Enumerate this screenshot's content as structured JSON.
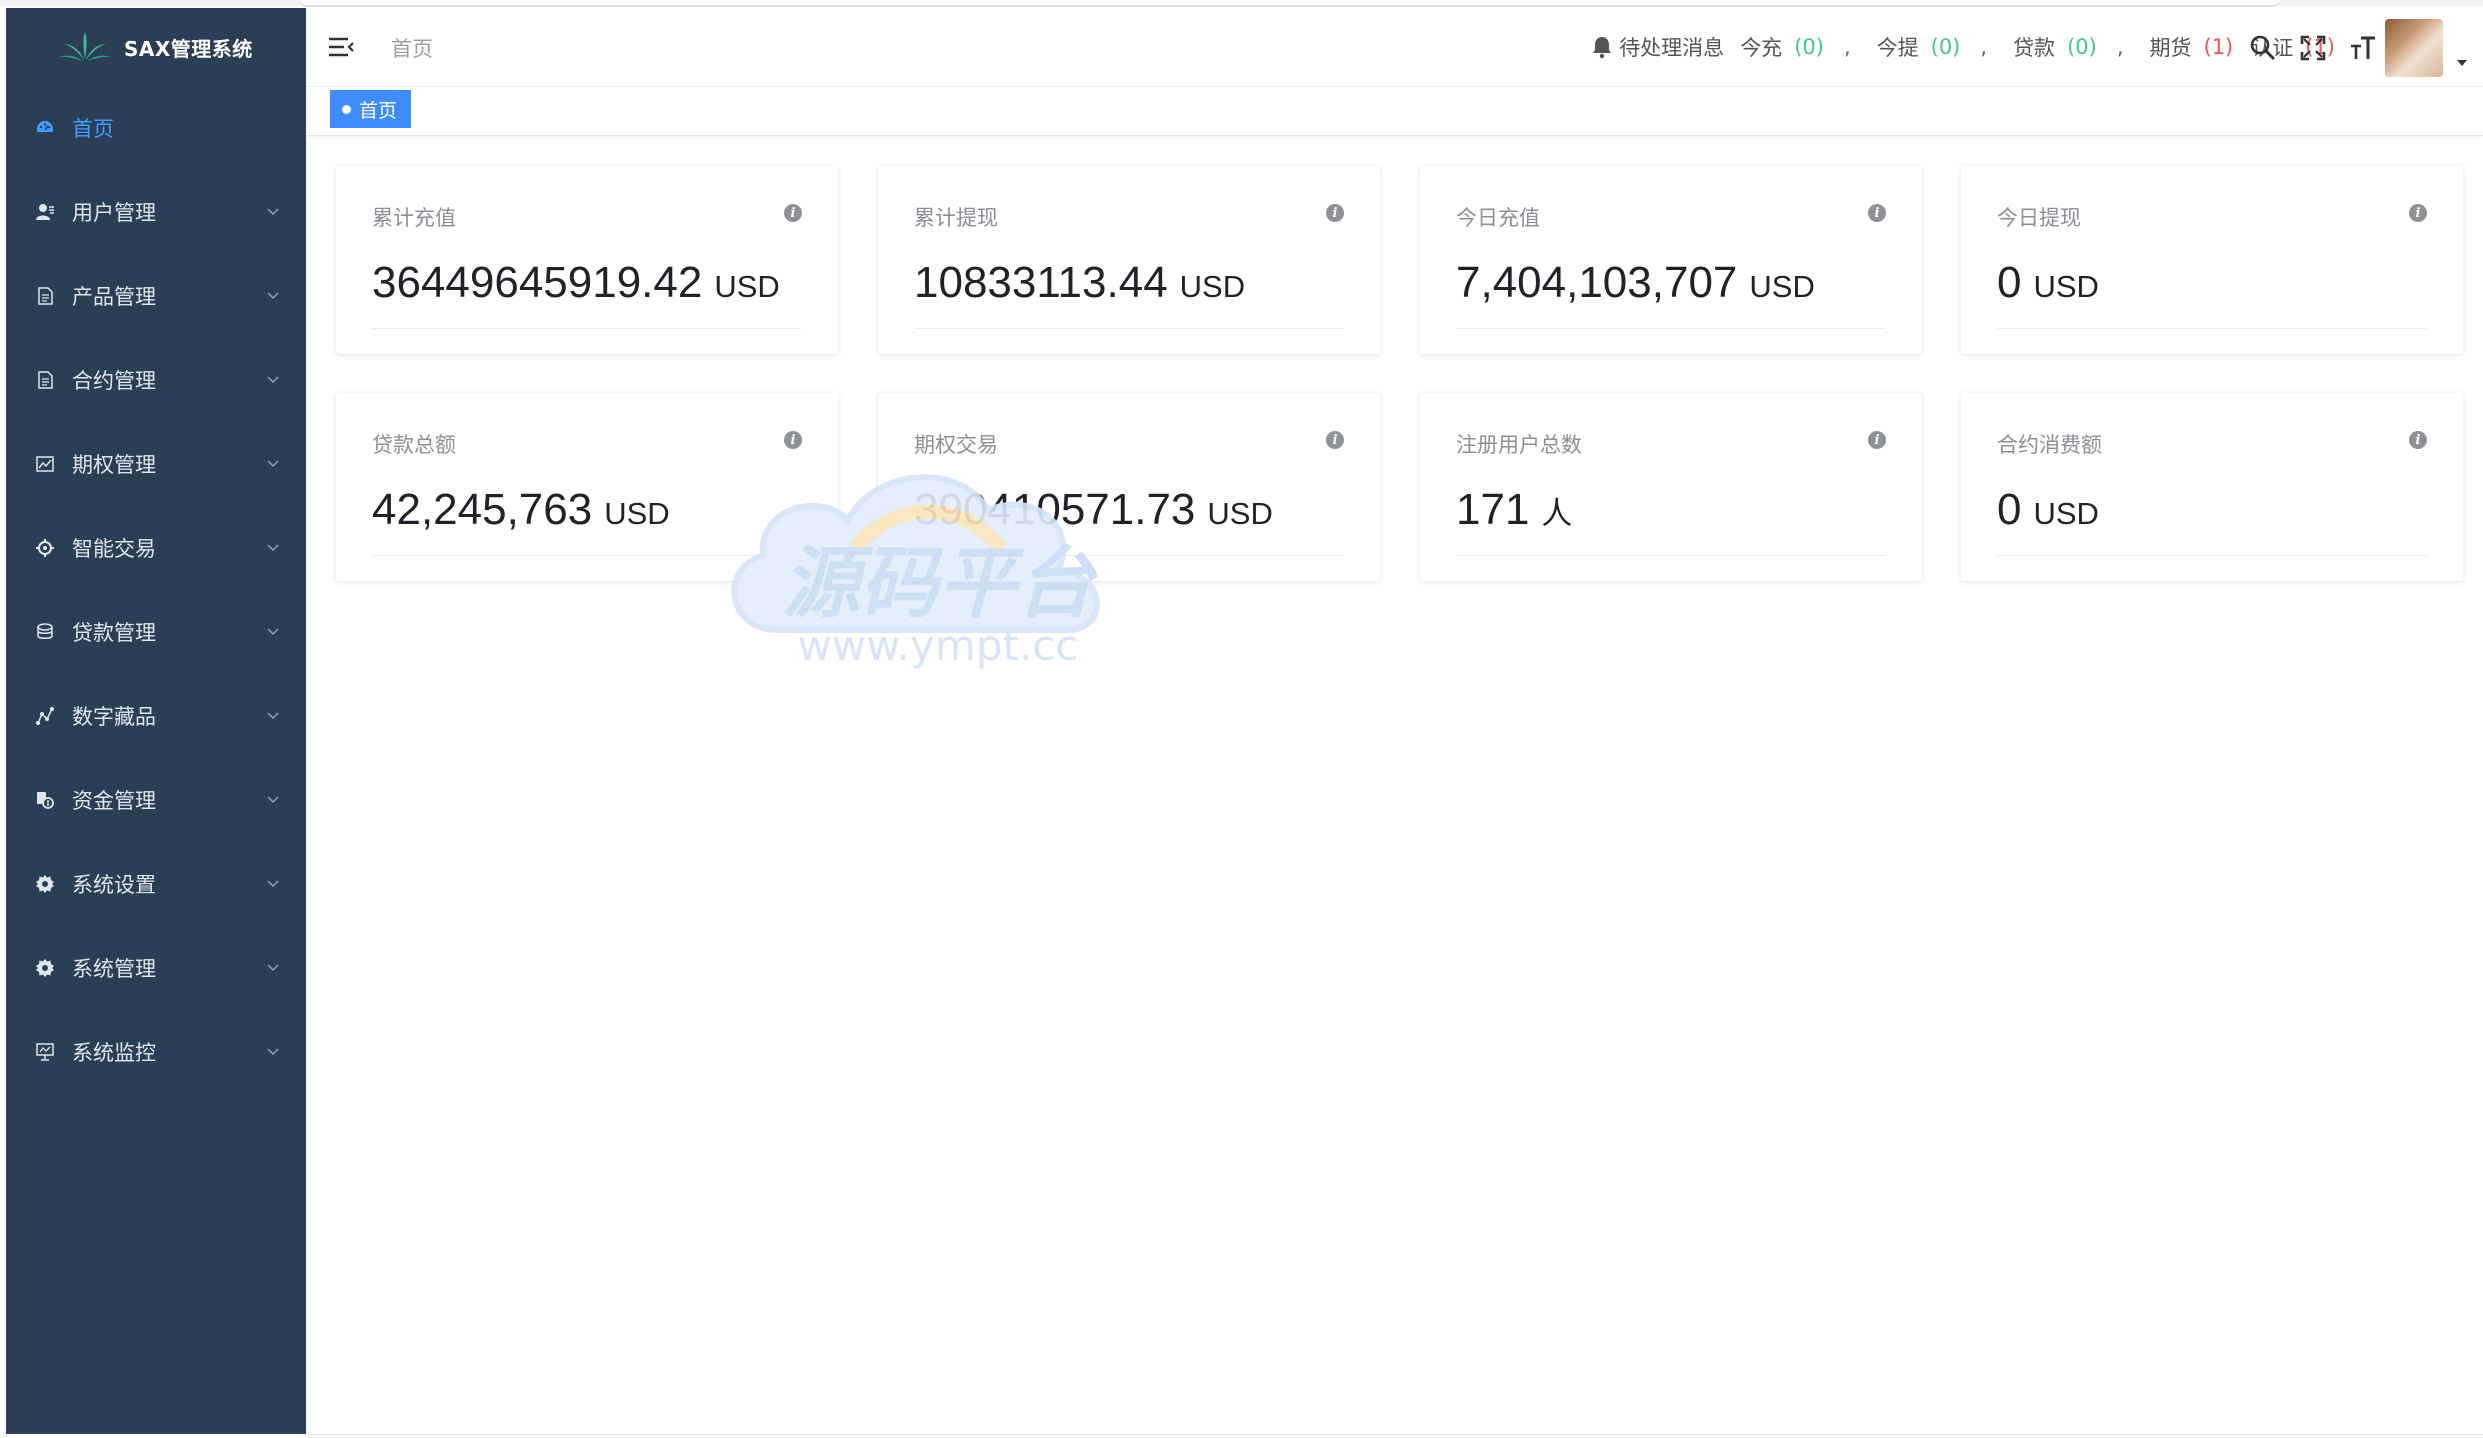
{
  "brand": {
    "title": "SAX管理系统"
  },
  "sidebar": {
    "items": [
      {
        "label": "首页",
        "icon": "dashboard-icon",
        "active": true
      },
      {
        "label": "用户管理",
        "icon": "users-icon"
      },
      {
        "label": "产品管理",
        "icon": "document-icon"
      },
      {
        "label": "合约管理",
        "icon": "document-icon"
      },
      {
        "label": "期权管理",
        "icon": "chart-icon"
      },
      {
        "label": "智能交易",
        "icon": "cog-icon"
      },
      {
        "label": "贷款管理",
        "icon": "coins-icon"
      },
      {
        "label": "数字藏品",
        "icon": "network-icon"
      },
      {
        "label": "资金管理",
        "icon": "money-icon"
      },
      {
        "label": "系统设置",
        "icon": "gear-icon"
      },
      {
        "label": "系统管理",
        "icon": "gear-icon"
      },
      {
        "label": "系统监控",
        "icon": "monitor-icon"
      }
    ]
  },
  "header": {
    "breadcrumb": "首页",
    "notice": {
      "label": "待处理消息",
      "items": [
        {
          "label": "今充",
          "count": "(0)",
          "color": "green"
        },
        {
          "label": "今提",
          "count": "(0)",
          "color": "green"
        },
        {
          "label": "贷款",
          "count": "(0)",
          "color": "green"
        },
        {
          "label": "期货",
          "count": "(1)",
          "color": "red"
        },
        {
          "label": "认证",
          "count": "(1)",
          "color": "red"
        }
      ],
      "separator": ","
    }
  },
  "tags": {
    "active": "首页"
  },
  "stats": [
    {
      "title": "累计充值",
      "value": "36449645919.42",
      "unit": "USD"
    },
    {
      "title": "累计提现",
      "value": "10833113.44",
      "unit": "USD"
    },
    {
      "title": "今日充值",
      "value": "7,404,103,707",
      "unit": "USD"
    },
    {
      "title": "今日提现",
      "value": "0",
      "unit": "USD"
    },
    {
      "title": "贷款总额",
      "value": "42,245,763",
      "unit": "USD"
    },
    {
      "title": "期权交易",
      "value": "390410571.73",
      "unit": "USD"
    },
    {
      "title": "注册用户总数",
      "value": "171",
      "unit": "人"
    },
    {
      "title": "合约消费额",
      "value": "0",
      "unit": "USD"
    }
  ],
  "watermark": {
    "text": "源码平台",
    "url": "www.ympt.cc"
  },
  "colors": {
    "sidebar_bg": "#2c3e55",
    "accent": "#409eff",
    "tag_bg": "#3f8cff",
    "count_green": "#43c78a",
    "count_red": "#f25454"
  }
}
